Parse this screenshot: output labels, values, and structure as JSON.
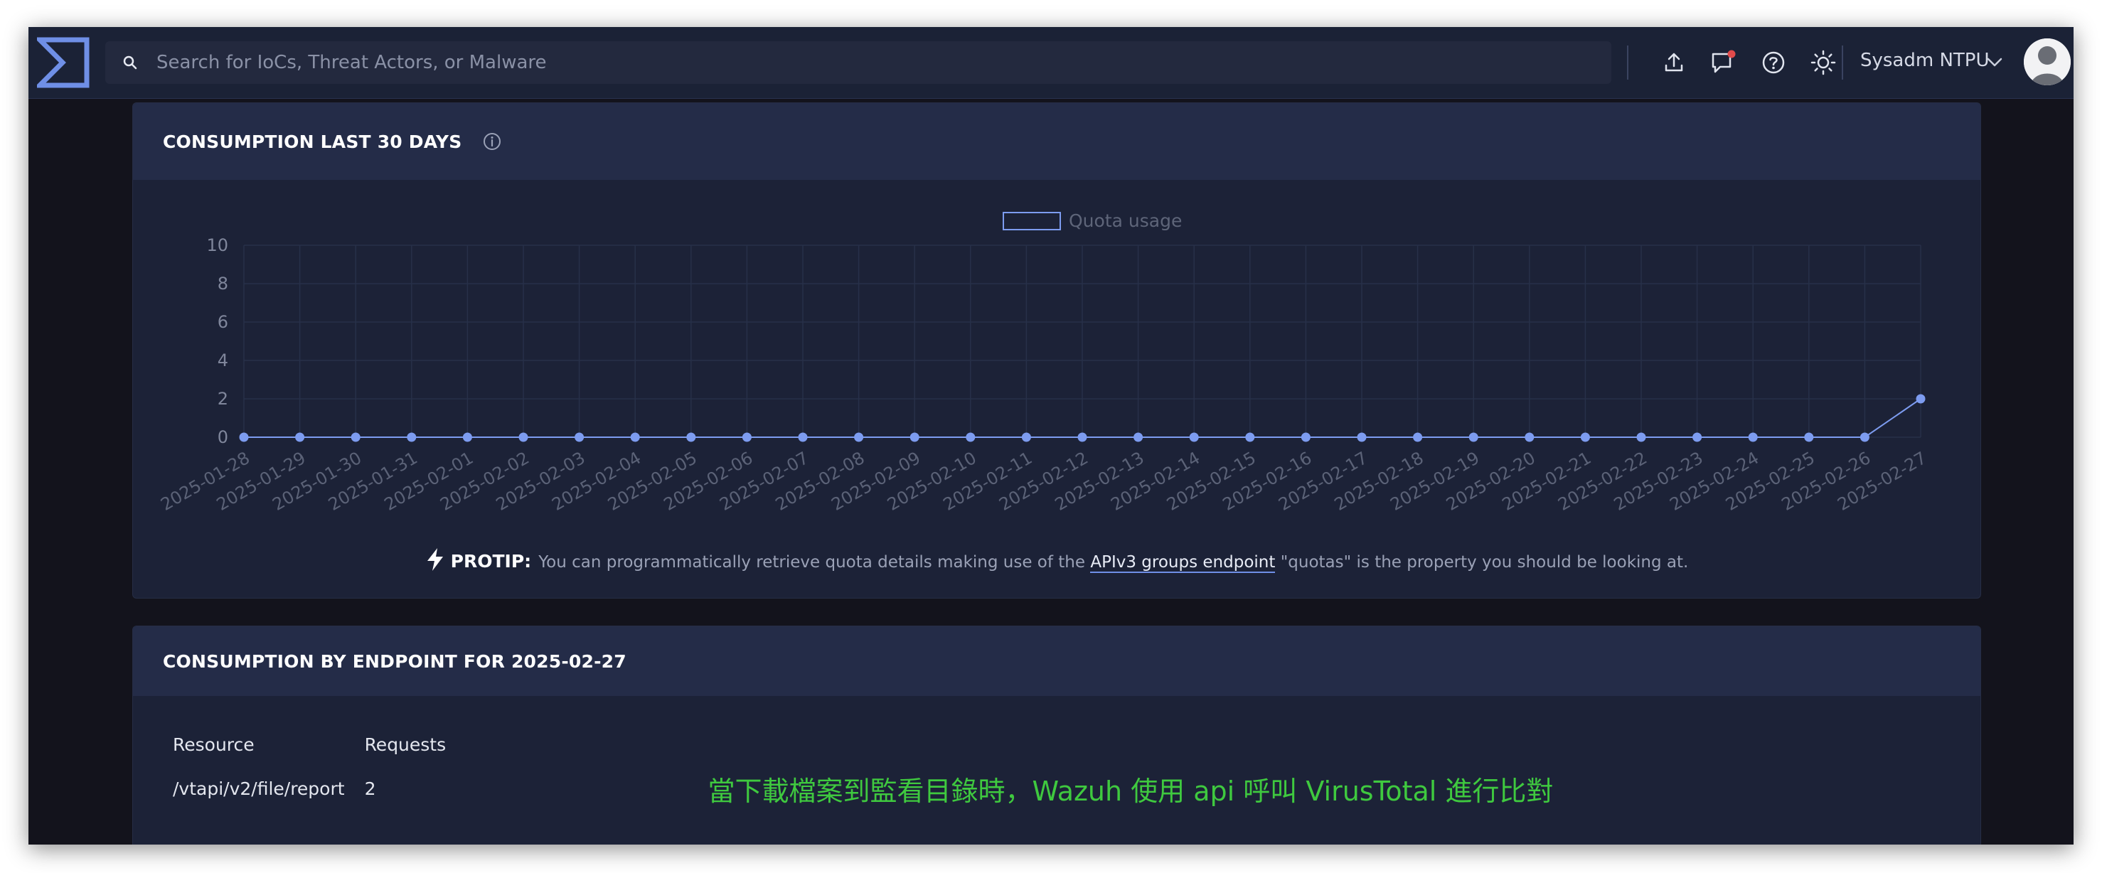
{
  "header": {
    "search_placeholder": "Search for IoCs, Threat Actors, or Malware",
    "user_name": "Sysadm NTPU",
    "icons": [
      "upload-icon",
      "chat-icon",
      "help-icon",
      "theme-sun-icon"
    ],
    "notification_dot_color": "#e24b4b"
  },
  "consumption_panel": {
    "title": "CONSUMPTION LAST 30 DAYS",
    "protip_label": "PROTIP:",
    "protip_text_before": "You can programmatically retrieve quota details making use of the",
    "protip_link": "APIv3 groups endpoint",
    "protip_text_after": "\"quotas\" is the property you should be looking at."
  },
  "chart_data": {
    "type": "line",
    "legend": [
      "Quota usage"
    ],
    "legend_position": "top-center",
    "grid": true,
    "ylim": [
      0,
      10
    ],
    "yticks": [
      0,
      2,
      4,
      6,
      8,
      10
    ],
    "x": [
      "2025-01-28",
      "2025-01-29",
      "2025-01-30",
      "2025-01-31",
      "2025-02-01",
      "2025-02-02",
      "2025-02-03",
      "2025-02-04",
      "2025-02-05",
      "2025-02-06",
      "2025-02-07",
      "2025-02-08",
      "2025-02-09",
      "2025-02-10",
      "2025-02-11",
      "2025-02-12",
      "2025-02-13",
      "2025-02-14",
      "2025-02-15",
      "2025-02-16",
      "2025-02-17",
      "2025-02-18",
      "2025-02-19",
      "2025-02-20",
      "2025-02-21",
      "2025-02-22",
      "2025-02-23",
      "2025-02-24",
      "2025-02-25",
      "2025-02-26",
      "2025-02-27"
    ],
    "series": [
      {
        "name": "Quota usage",
        "color": "#7d9cf0",
        "values": [
          0,
          0,
          0,
          0,
          0,
          0,
          0,
          0,
          0,
          0,
          0,
          0,
          0,
          0,
          0,
          0,
          0,
          0,
          0,
          0,
          0,
          0,
          0,
          0,
          0,
          0,
          0,
          0,
          0,
          0,
          2
        ]
      }
    ]
  },
  "endpoint_panel": {
    "title": "CONSUMPTION BY ENDPOINT FOR 2025-02-27",
    "columns": [
      "Resource",
      "Requests"
    ],
    "rows": [
      [
        "/vtapi/v2/file/report",
        "2"
      ]
    ]
  },
  "caption": "當下載檔案到監看目錄時，Wazuh 使用 api 呼叫 VirusTotal 進行比對",
  "colors": {
    "accent": "#7d9cf0",
    "caption": "#3fc93f"
  }
}
